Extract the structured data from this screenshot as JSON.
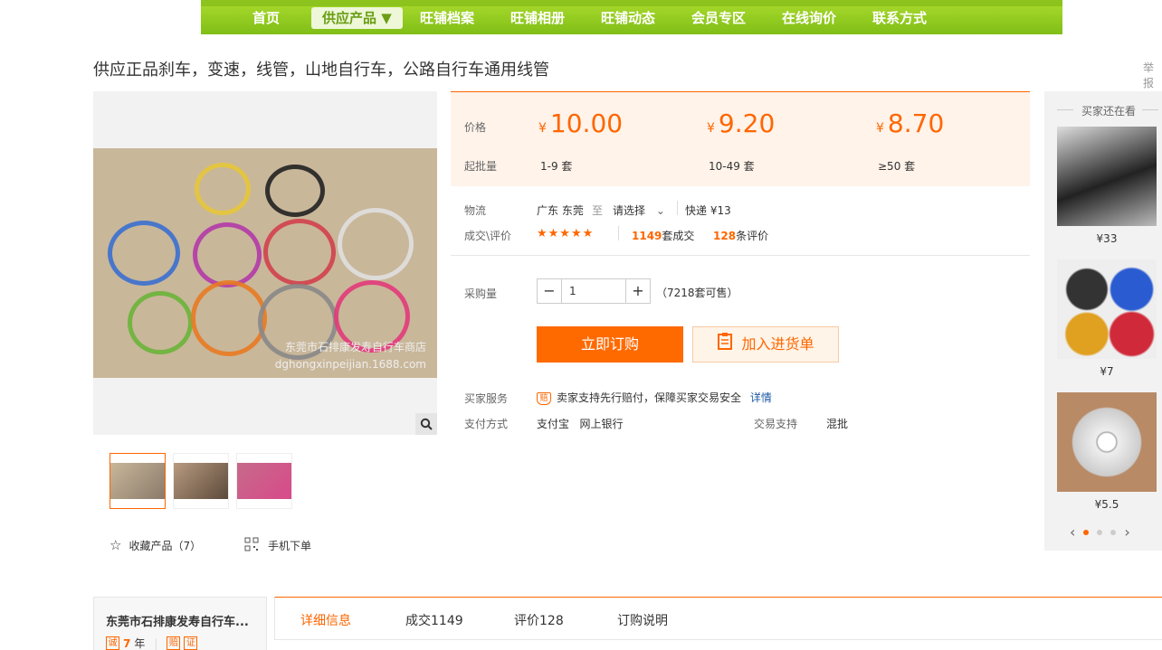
{
  "nav": {
    "items": [
      {
        "label": "首页",
        "active": false
      },
      {
        "label": "供应产品 ▼",
        "active": true
      },
      {
        "label": "旺铺档案",
        "active": false
      },
      {
        "label": "旺铺相册",
        "active": false
      },
      {
        "label": "旺铺动态",
        "active": false
      },
      {
        "label": "会员专区",
        "active": false
      },
      {
        "label": "在线询价",
        "active": false
      },
      {
        "label": "联系方式",
        "active": false
      }
    ]
  },
  "product": {
    "title": "供应正品刹车，变速，线管，山地自行车，公路自行车通用线管",
    "report_label": "举报",
    "watermark_cn": "东莞市石排康发寿自行车商店",
    "watermark_url": "dghongxinpeijian.1688.com",
    "favorite_label": "收藏产品（7）",
    "mobile_label": "手机下单"
  },
  "pricing": {
    "price_label": "价格",
    "moq_label": "起批量",
    "currency": "¥",
    "tiers": [
      {
        "price": "10.00",
        "range": "1-9 套"
      },
      {
        "price": "9.20",
        "range": "10-49 套"
      },
      {
        "price": "8.70",
        "range": "≥50 套"
      }
    ]
  },
  "logistics": {
    "label": "物流",
    "from": "广东 东莞",
    "to_word": "至",
    "select_placeholder": "请选择",
    "express": "快递 ¥13"
  },
  "deals": {
    "label": "成交\\评价",
    "stars": "★★★★★",
    "deal_count": "1149",
    "deal_suffix": "套成交",
    "review_count": "128",
    "review_suffix": "条评价"
  },
  "purchase": {
    "label": "采购量",
    "minus": "−",
    "quantity": "1",
    "plus": "+",
    "available": "（7218套可售）",
    "buy_label": "立即订购",
    "cart_label": "加入进货单"
  },
  "service": {
    "label": "买家服务",
    "icon_text": "赔",
    "text": "卖家支持先行赔付，保障买家交易安全",
    "detail_link": "详情",
    "pay_label": "支付方式",
    "pay_methods": "支付宝   网上银行",
    "trade_label": "交易支持",
    "trade_value": "混批"
  },
  "side": {
    "header": "买家还在看",
    "items": [
      {
        "price": "¥33"
      },
      {
        "price": "¥7"
      },
      {
        "price": "¥5.5"
      }
    ]
  },
  "shop": {
    "name": "东莞市石排康发寿自行车...",
    "years": "7",
    "years_unit": "年"
  },
  "tabs": [
    {
      "label": "详细信息",
      "active": true
    },
    {
      "label": "成交1149",
      "active": false
    },
    {
      "label": "评价128",
      "active": false
    },
    {
      "label": "订购说明",
      "active": false
    }
  ],
  "colors": {
    "accent": "#ff6600",
    "nav_green": "#8cc31c"
  }
}
